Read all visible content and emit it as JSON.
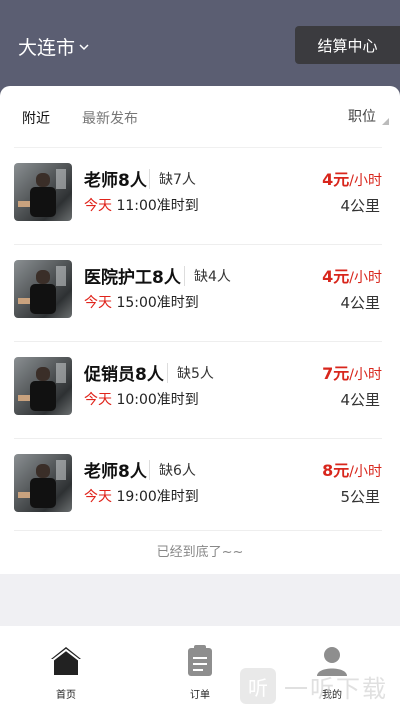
{
  "header": {
    "city": "大连市",
    "settle_button": "结算中心"
  },
  "filters": {
    "nearby": "附近",
    "latest": "最新发布",
    "position": "职位"
  },
  "jobs": [
    {
      "title": "老师8人",
      "shortage": "缺7人",
      "day": "今天",
      "time": "11:00准时到",
      "wage": "4元",
      "unit": "/小时",
      "distance": "4公里"
    },
    {
      "title": "医院护工8人",
      "shortage": "缺4人",
      "day": "今天",
      "time": "15:00准时到",
      "wage": "4元",
      "unit": "/小时",
      "distance": "4公里"
    },
    {
      "title": "促销员8人",
      "shortage": "缺5人",
      "day": "今天",
      "time": "10:00准时到",
      "wage": "7元",
      "unit": "/小时",
      "distance": "4公里"
    },
    {
      "title": "老师8人",
      "shortage": "缺6人",
      "day": "今天",
      "time": "19:00准时到",
      "wage": "8元",
      "unit": "/小时",
      "distance": "5公里"
    }
  ],
  "end_note": "已经到底了~~",
  "tabbar": {
    "home": "首页",
    "orders": "订单",
    "mine": "我的"
  },
  "watermark": {
    "logo": "听",
    "text": "一听下载"
  },
  "colors": {
    "header_bg": "#5b5e72",
    "accent_red": "#d8261c",
    "button_dark": "#3b3b3f"
  }
}
